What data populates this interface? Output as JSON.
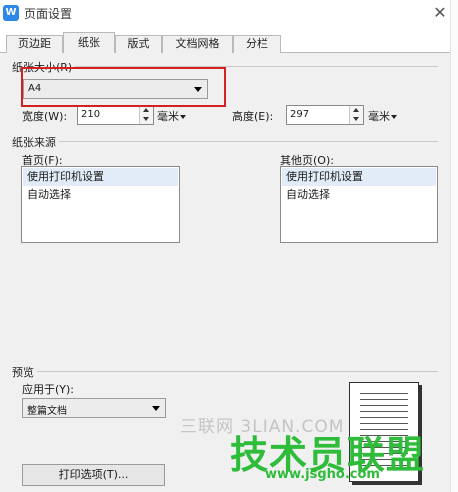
{
  "window": {
    "title": "页面设置",
    "close_glyph": "✕",
    "app_icon_glyph": "W"
  },
  "tabs": [
    {
      "label": "页边距",
      "active": false
    },
    {
      "label": "纸张",
      "active": true
    },
    {
      "label": "版式",
      "active": false
    },
    {
      "label": "文档网格",
      "active": false
    },
    {
      "label": "分栏",
      "active": false
    }
  ],
  "paper_size": {
    "group_label": "纸张大小(R)",
    "selected": "A4",
    "width_label": "宽度(W):",
    "width_value": "210",
    "width_unit": "毫米",
    "height_label": "高度(E):",
    "height_value": "297",
    "height_unit": "毫米"
  },
  "paper_source": {
    "group_label": "纸张来源",
    "first_page_label": "首页(F):",
    "first_page_items": [
      "使用打印机设置",
      "自动选择"
    ],
    "other_pages_label": "其他页(O):",
    "other_pages_items": [
      "使用打印机设置",
      "自动选择"
    ]
  },
  "preview": {
    "group_label": "预览",
    "apply_to_label": "应用于(Y):",
    "apply_to_value": "整篇文档",
    "print_options_button": "打印选项(T)..."
  },
  "watermark": {
    "line1": "三联网 3LIAN.COM",
    "line2": "技术员联盟",
    "line3": "www.jsgho.com"
  },
  "colors": {
    "highlight": "#d32020",
    "selection": "#e2ecf8",
    "watermark_green": "#2fbc3a"
  }
}
